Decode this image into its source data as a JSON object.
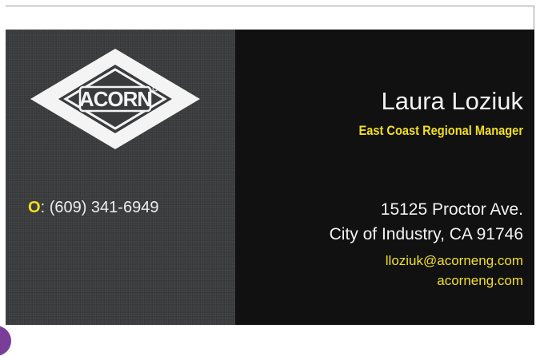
{
  "card": {
    "logo_text": "ACORN",
    "phone_label": "O",
    "phone_separator": ":",
    "phone_number": "(609) 341-6949",
    "name": "Laura Loziuk",
    "job_title": "East Coast Regional Manager",
    "address_line1": "15125 Proctor Ave.",
    "address_line2": "City of Industry, CA 91746",
    "email": "lloziuk@acorneng.com",
    "website": "acorneng.com"
  },
  "colors": {
    "accent_yellow": "#f3df1e",
    "card_left_bg": "#3a3b3d",
    "card_right_bg": "#111111",
    "text_white": "#f2f2f2",
    "corner_badge": "#7a3d99"
  }
}
